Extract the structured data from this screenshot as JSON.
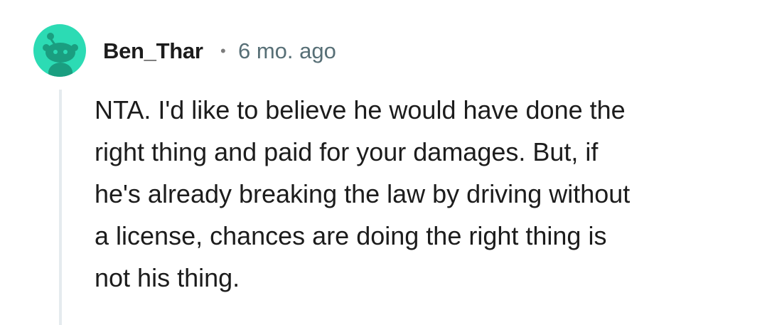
{
  "comment": {
    "author": "Ben_Thar",
    "separator": "•",
    "age": "6 mo. ago",
    "body_lines": [
      "NTA. I'd like to believe he would have done the",
      "right thing and paid for your damages. But, if",
      "he's already breaking the law by driving without",
      "a license, chances are doing the right thing is",
      "not his thing."
    ],
    "avatar_icon": "snoo-avatar-icon"
  },
  "colors": {
    "avatar_bg": "#2cdbb4",
    "text": "#1c1c1c",
    "meta": "#576f76",
    "thread_line": "#e5ebee"
  }
}
